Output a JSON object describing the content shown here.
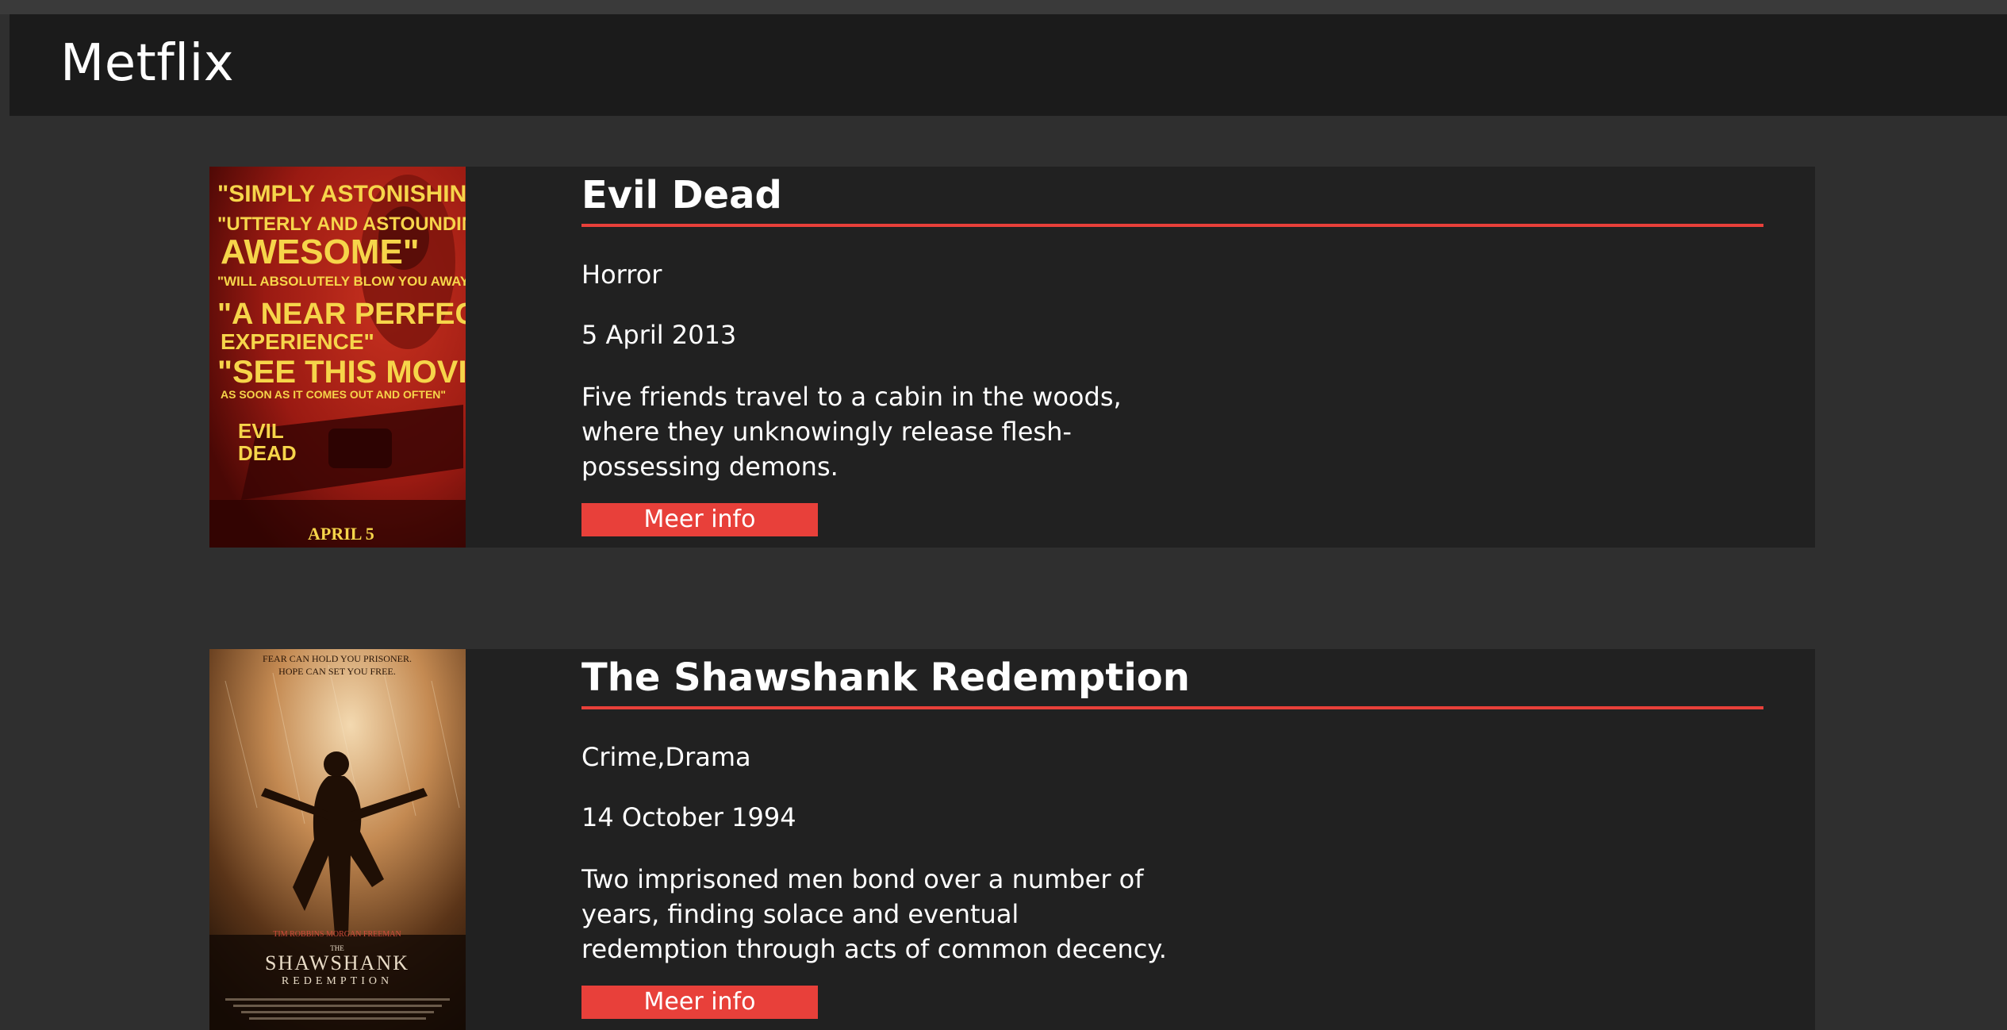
{
  "app": {
    "title": "Metflix"
  },
  "movies": [
    {
      "title": "Evil Dead",
      "genre": "Horror",
      "release_date": "5 April 2013",
      "description": "Five friends travel to a cabin in the woods, where they unknowingly release flesh-possessing demons.",
      "button_label": "Meer info",
      "poster": {
        "quotes": [
          "\"SIMPLY ASTONISHING\"",
          "\"UTTERLY AND ASTOUNDINGLY",
          "AWESOME\"",
          "\"WILL ABSOLUTELY BLOW YOU AWAY\"",
          "\"A NEAR PERFECT",
          "EXPERIENCE\"",
          "\"SEE THIS MOVIE",
          "AS SOON AS IT COMES OUT AND OFTEN\""
        ],
        "logo_line1": "EVIL",
        "logo_line2": "DEAD",
        "date": "APRIL 5"
      }
    },
    {
      "title": "The Shawshank Redemption",
      "genre": "Crime,Drama",
      "release_date": "14 October 1994",
      "description": "Two imprisoned men bond over a number of years, finding solace and eventual redemption through acts of common decency.",
      "button_label": "Meer info",
      "poster": {
        "tagline1": "FEAR CAN HOLD YOU PRISONER.",
        "tagline2": "HOPE CAN SET YOU FREE.",
        "actors": "TIM ROBBINS    MORGAN FREEMAN",
        "the": "THE",
        "title1": "SHAWSHANK",
        "title2": "REDEMPTION"
      }
    }
  ],
  "colors": {
    "accent": "#e8403a",
    "page_bg": "#2f2f2f",
    "header_bg": "#1b1b1b",
    "card_bg": "#212121"
  }
}
